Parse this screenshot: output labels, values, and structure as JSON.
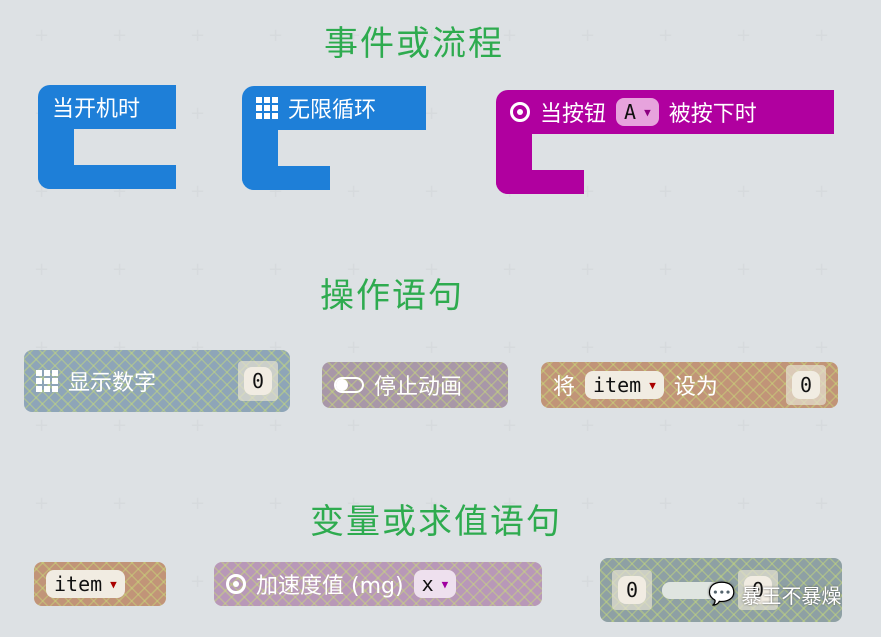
{
  "sections": {
    "events": "事件或流程",
    "actions": "操作语句",
    "values": "变量或求值语句"
  },
  "events": {
    "on_start": "当开机时",
    "forever": "无限循环",
    "on_button": {
      "prefix": "当按钮",
      "button": "A",
      "suffix": "被按下时"
    }
  },
  "actions": {
    "show_number": {
      "label": "显示数字",
      "value": "0"
    },
    "stop_animation": "停止动画",
    "set_var": {
      "prefix": "将",
      "var": "item",
      "suffix": "设为",
      "value": "0"
    }
  },
  "values": {
    "item": "item",
    "accel": {
      "label": "加速度值 (mg)",
      "axis": "x"
    },
    "compare": {
      "left": "0",
      "right": "0"
    }
  },
  "watermark": "暴王不暴燥",
  "colors": {
    "title": "#2eab4f",
    "event_blue": "#1e7fd8",
    "input_magenta": "#b0009f"
  }
}
